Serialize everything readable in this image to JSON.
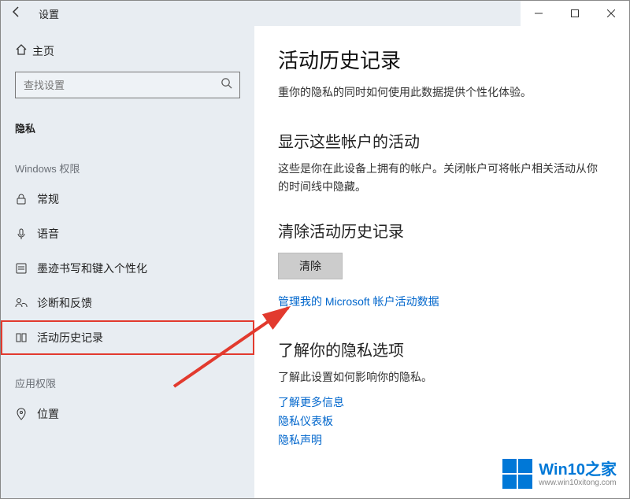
{
  "window": {
    "title": "设置"
  },
  "sidebar": {
    "home": "主页",
    "search_placeholder": "查找设置",
    "privacy_label": "隐私",
    "cat_windows": "Windows 权限",
    "cat_app": "应用权限",
    "items": {
      "general": "常规",
      "speech": "语音",
      "inking": "墨迹书写和键入个性化",
      "diagnostics": "诊断和反馈",
      "activity": "活动历史记录",
      "location": "位置"
    }
  },
  "content": {
    "h1": "活动历史记录",
    "p1": "重你的隐私的同时如何使用此数据提供个性化体验。",
    "h2a": "显示这些帐户的活动",
    "p2": "这些是你在此设备上拥有的帐户。关闭帐户可将帐户相关活动从你的时间线中隐藏。",
    "h2b": "清除活动历史记录",
    "clear_btn": "清除",
    "manage_link": "管理我的 Microsoft 帐户活动数据",
    "h2c": "了解你的隐私选项",
    "p3": "了解此设置如何影响你的隐私。",
    "link_more": "了解更多信息",
    "link_dashboard": "隐私仪表板",
    "link_statement": "隐私声明"
  },
  "watermark": {
    "brand": "Win10之家",
    "url": "www.win10xitong.com"
  }
}
